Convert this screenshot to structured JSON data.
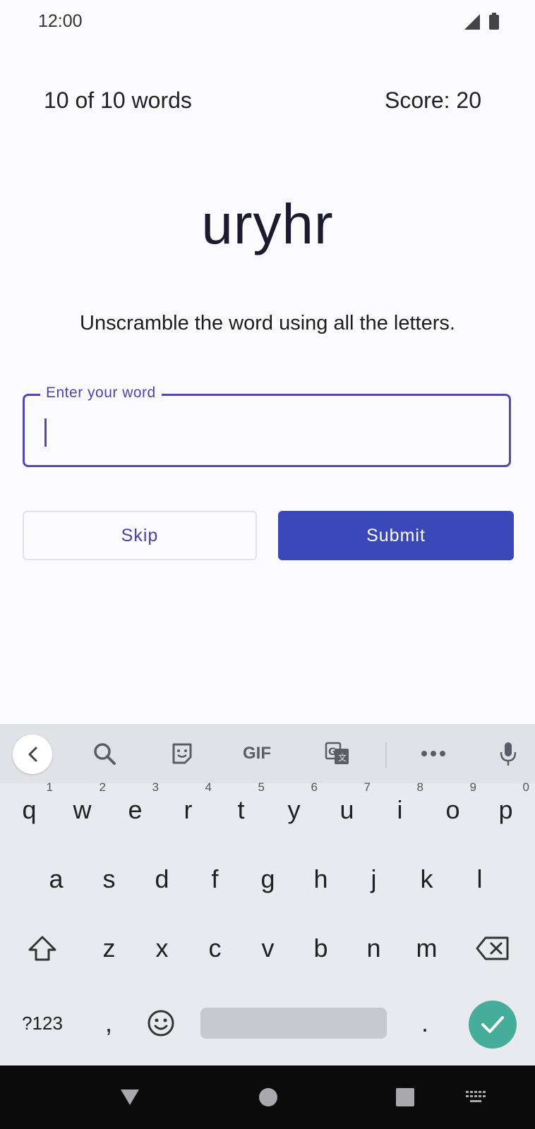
{
  "status_bar": {
    "time": "12:00"
  },
  "game": {
    "progress": "10 of 10 words",
    "score": "Score: 20",
    "scrambled_word": "uryhr",
    "instructions": "Unscramble the word using all the letters."
  },
  "input": {
    "label": "Enter your word",
    "value": ""
  },
  "buttons": {
    "skip": "Skip",
    "submit": "Submit"
  },
  "keyboard": {
    "toolbar": {
      "items": [
        "back-icon",
        "search-icon",
        "sticker-icon",
        "GIF",
        "translate-icon",
        "more-icon",
        "mic-icon"
      ],
      "gif_label": "GIF"
    },
    "row1": [
      {
        "k": "q",
        "n": "1"
      },
      {
        "k": "w",
        "n": "2"
      },
      {
        "k": "e",
        "n": "3"
      },
      {
        "k": "r",
        "n": "4"
      },
      {
        "k": "t",
        "n": "5"
      },
      {
        "k": "y",
        "n": "6"
      },
      {
        "k": "u",
        "n": "7"
      },
      {
        "k": "i",
        "n": "8"
      },
      {
        "k": "o",
        "n": "9"
      },
      {
        "k": "p",
        "n": "0"
      }
    ],
    "row2": [
      "a",
      "s",
      "d",
      "f",
      "g",
      "h",
      "j",
      "k",
      "l"
    ],
    "row3": [
      "z",
      "x",
      "c",
      "v",
      "b",
      "n",
      "m"
    ],
    "row4": {
      "symbols": "?123",
      "comma": ",",
      "period": "."
    }
  },
  "colors": {
    "accent": "#3b48b8",
    "field_outline": "#5248b0",
    "enter_key": "#45ad9a"
  }
}
